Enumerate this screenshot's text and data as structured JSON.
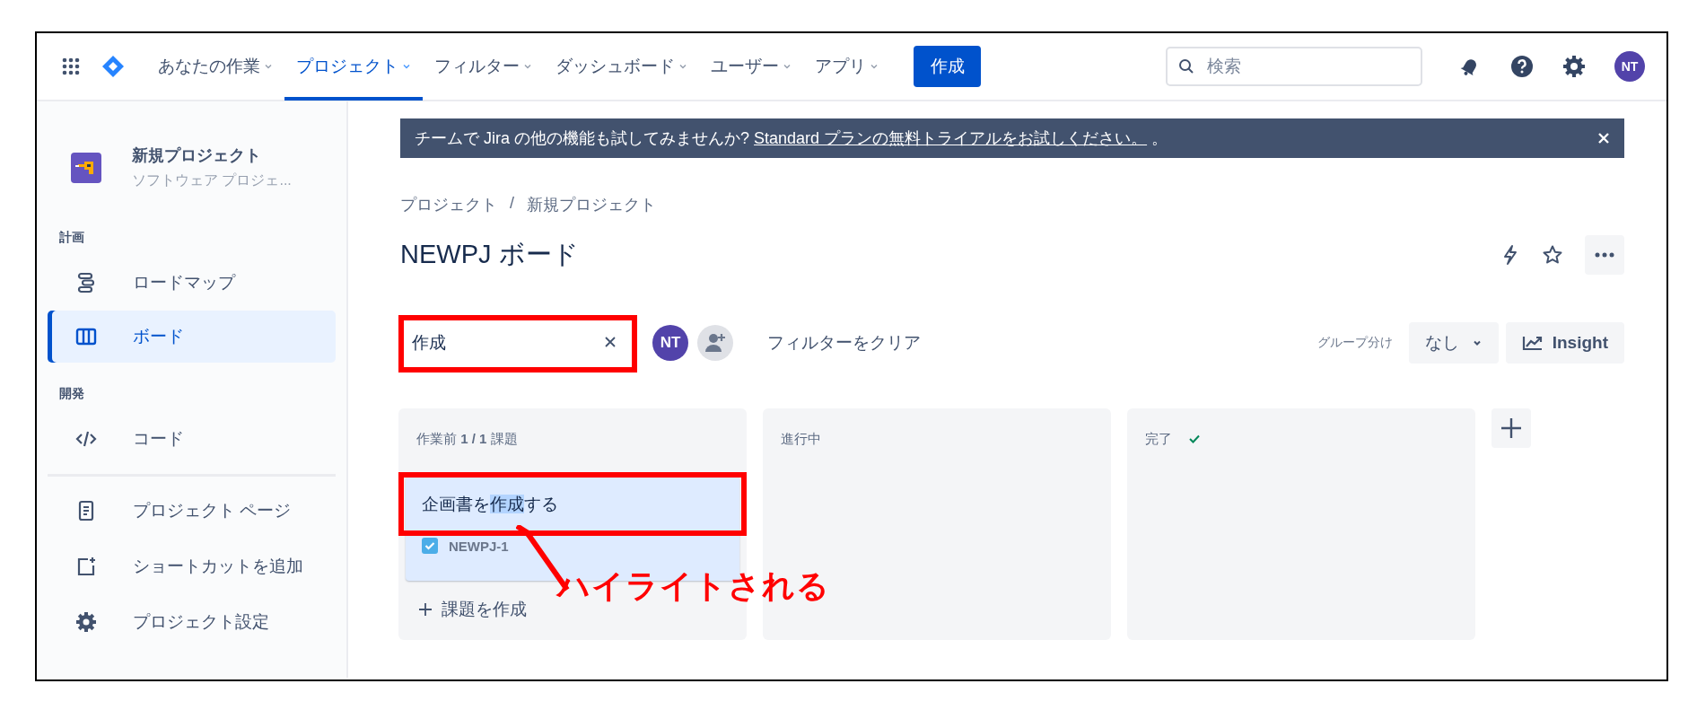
{
  "nav": {
    "items": [
      {
        "label": "あなたの作業",
        "selected": false
      },
      {
        "label": "プロジェクト",
        "selected": true
      },
      {
        "label": "フィルター",
        "selected": false
      },
      {
        "label": "ダッシュボード",
        "selected": false
      },
      {
        "label": "ユーザー",
        "selected": false
      },
      {
        "label": "アプリ",
        "selected": false
      }
    ],
    "create_button": "作成",
    "search": {
      "placeholder": "検索"
    },
    "avatar": "NT"
  },
  "sidebar": {
    "project": {
      "name": "新規プロジェクト",
      "type": "ソフトウェア プロジェ..."
    },
    "sections": [
      {
        "heading": "計画",
        "items": [
          {
            "label": "ロードマップ",
            "selected": false
          },
          {
            "label": "ボード",
            "selected": true
          }
        ]
      },
      {
        "heading": "開発",
        "items": [
          {
            "label": "コード",
            "selected": false
          }
        ]
      }
    ],
    "footer_items": [
      {
        "label": "プロジェクト ページ"
      },
      {
        "label": "ショートカットを追加"
      },
      {
        "label": "プロジェクト設定"
      }
    ]
  },
  "banner": {
    "text": "チームで Jira の他の機能も試してみませんか?",
    "link": "Standard プランの無料トライアルをお試しください。",
    "suffix": "。"
  },
  "breadcrumb": [
    "プロジェクト",
    "/",
    "新規プロジェクト"
  ],
  "title": "NEWPJ ボード",
  "filter_bar": {
    "search": {
      "value": "作成"
    },
    "avatar": "NT",
    "clear_button": "フィルターをクリア",
    "group_label": "グループ分け",
    "group_value": "なし",
    "insight_button": "Insight"
  },
  "columns": [
    {
      "title": "作業前 **1 / 1** 課題",
      "done": false,
      "cards": [
        {
          "title_parts": [
            {
              "text": "企画書を",
              "highlighted": false
            },
            {
              "text": "作成",
              "highlighted": true
            },
            {
              "text": "する",
              "highlighted": false
            }
          ],
          "key": "NEWPJ-1"
        }
      ],
      "create_label": "課題を作成"
    },
    {
      "title": "進行中",
      "done": false
    },
    {
      "title": "完了",
      "done": true
    }
  ],
  "annotation": {
    "label": "ハイライトされる"
  }
}
